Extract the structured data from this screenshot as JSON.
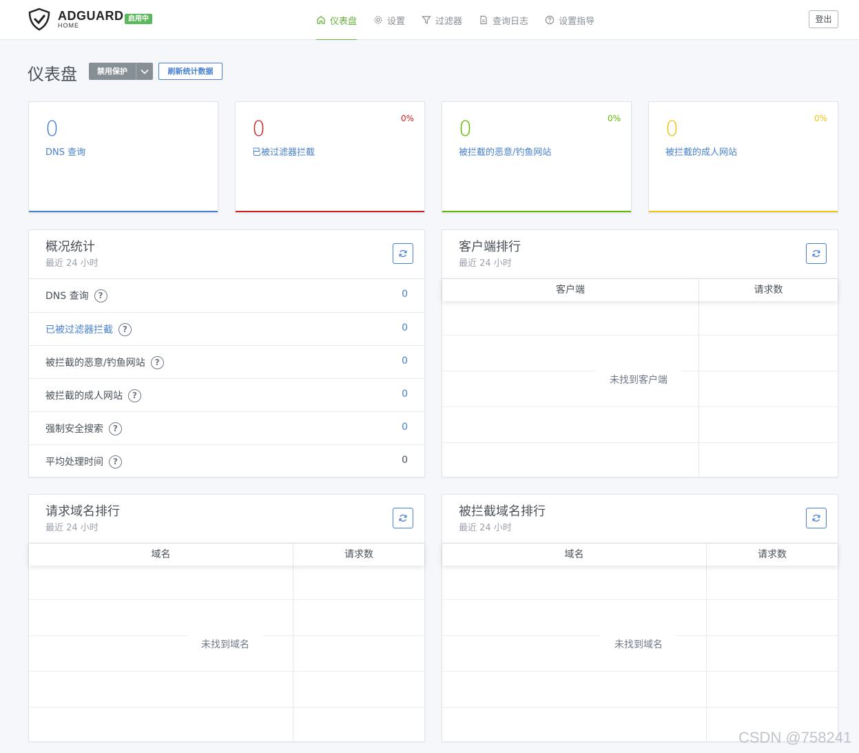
{
  "header": {
    "brand": "ADGUARD",
    "brand_sub": "HOME",
    "status_badge": "启用中",
    "nav": [
      {
        "label": "仪表盘",
        "icon": "home-icon",
        "active": true
      },
      {
        "label": "设置",
        "icon": "gear-icon",
        "active": false
      },
      {
        "label": "过滤器",
        "icon": "filter-icon",
        "active": false
      },
      {
        "label": "查询日志",
        "icon": "log-icon",
        "active": false
      },
      {
        "label": "设置指导",
        "icon": "help-icon",
        "active": false
      }
    ],
    "logout": "登出"
  },
  "page": {
    "title": "仪表盘",
    "disable_protection": "禁用保护",
    "refresh_stats": "刷新统计数据"
  },
  "stats": [
    {
      "value": "0",
      "label": "DNS 查询",
      "percent": "",
      "color": "#467fcf"
    },
    {
      "value": "0",
      "label": "已被过滤器拦截",
      "percent": "0%",
      "color": "#cd201f"
    },
    {
      "value": "0",
      "label": "被拦截的恶意/钓鱼网站",
      "percent": "0%",
      "color": "#5eba00"
    },
    {
      "value": "0",
      "label": "被拦截的成人网站",
      "percent": "0%",
      "color": "#f1c40f"
    }
  ],
  "overview": {
    "title": "概况统计",
    "subtitle": "最近 24 小时",
    "rows": [
      {
        "label": "DNS 查询",
        "value": "0"
      },
      {
        "label": "已被过滤器拦截",
        "value": "0"
      },
      {
        "label": "被拦截的恶意/钓鱼网站",
        "value": "0"
      },
      {
        "label": "被拦截的成人网站",
        "value": "0"
      },
      {
        "label": "强制安全搜索",
        "value": "0"
      },
      {
        "label": "平均处理时间",
        "value": "0"
      }
    ]
  },
  "clients": {
    "title": "客户端排行",
    "subtitle": "最近 24 小时",
    "col1": "客户端",
    "col2": "请求数",
    "empty": "未找到客户端"
  },
  "queried": {
    "title": "请求域名排行",
    "subtitle": "最近 24 小时",
    "col1": "域名",
    "col2": "请求数",
    "empty": "未找到域名"
  },
  "blocked": {
    "title": "被拦截域名排行",
    "subtitle": "最近 24 小时",
    "col1": "域名",
    "col2": "请求数",
    "empty": "未找到域名"
  },
  "watermark": "CSDN @758241",
  "help_mark": "?"
}
